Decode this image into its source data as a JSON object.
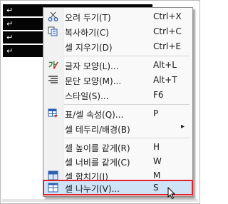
{
  "document": {
    "paragraph_mark": "↵"
  },
  "menu": {
    "items": [
      {
        "label": "오려 두기(T)",
        "shortcut": "Ctrl+X",
        "icon": "scissors-icon"
      },
      {
        "label": "복사하기(C)",
        "shortcut": "Ctrl+C",
        "icon": "copy-icon"
      },
      {
        "label": "셀 지우기(D)",
        "shortcut": "Ctrl+E",
        "icon": ""
      },
      {
        "label": "글자 모양(L)...",
        "shortcut": "Alt+L",
        "icon": "char-shape-icon"
      },
      {
        "label": "문단 모양(M)...",
        "shortcut": "Alt+T",
        "icon": "paragraph-shape-icon"
      },
      {
        "label": "스타일(S)...",
        "shortcut": "F6",
        "icon": ""
      },
      {
        "label": "표/셀 속성(Q)...",
        "shortcut": "P",
        "icon": "table-props-icon"
      },
      {
        "label": "셀 테두리/배경(B)",
        "shortcut": "",
        "icon": "",
        "submenu": true
      },
      {
        "label": "셀 높이를 같게(R)",
        "shortcut": "H",
        "icon": ""
      },
      {
        "label": "셀 너비를 같게(C)",
        "shortcut": "W",
        "icon": ""
      },
      {
        "label": "셀 합치기(J)",
        "shortcut": "M",
        "icon": "merge-cells-icon"
      },
      {
        "label": "셀 나누기(V)...",
        "shortcut": "S",
        "icon": "split-cells-icon",
        "highlighted": true
      }
    ]
  },
  "colors": {
    "highlight_bg": "#cfe3f7",
    "highlight_border": "#e0242b",
    "cell_bg": "#050505"
  }
}
